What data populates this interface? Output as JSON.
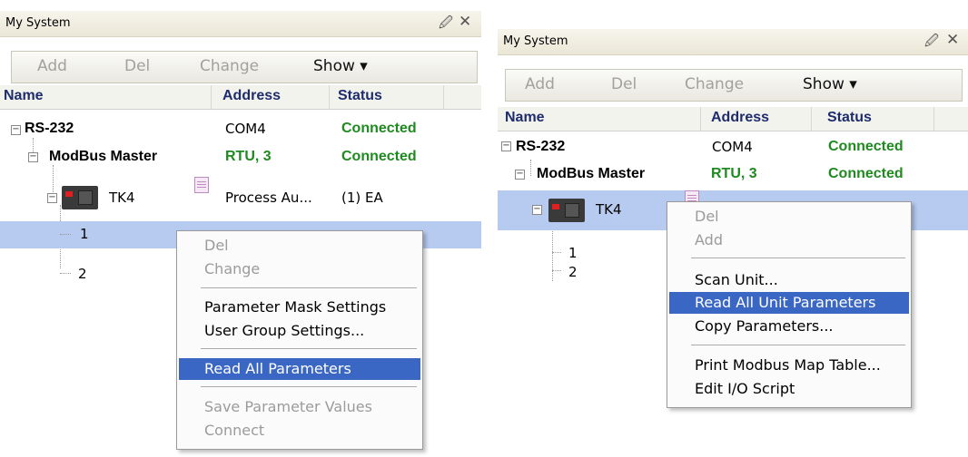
{
  "left": {
    "title": "My System",
    "toolbar": {
      "add": "Add",
      "del": "Del",
      "change": "Change",
      "show": "Show ▾"
    },
    "columns": {
      "name": "Name",
      "address": "Address",
      "status": "Status"
    },
    "rows": [
      {
        "name": "RS-232",
        "address": "COM4",
        "status": "Connected"
      },
      {
        "name": "ModBus Master",
        "address": "RTU, 3",
        "status": "Connected"
      },
      {
        "name": "TK4",
        "address": "Process Au...",
        "status": "(1) EA"
      },
      {
        "name": "1"
      },
      {
        "name": "2"
      }
    ],
    "menu": [
      "Del",
      "Change",
      "Parameter Mask Settings",
      "User Group Settings...",
      "Read All Parameters",
      "Save Parameter Values",
      "Connect"
    ]
  },
  "right": {
    "title": "My System",
    "toolbar": {
      "add": "Add",
      "del": "Del",
      "change": "Change",
      "show": "Show ▾"
    },
    "columns": {
      "name": "Name",
      "address": "Address",
      "status": "Status"
    },
    "rows": [
      {
        "name": "RS-232",
        "address": "COM4",
        "status": "Connected"
      },
      {
        "name": "ModBus Master",
        "address": "RTU, 3",
        "status": "Connected"
      },
      {
        "name": "TK4"
      },
      {
        "name": "1"
      },
      {
        "name": "2"
      }
    ],
    "menu": [
      "Del",
      "Add",
      "Scan Unit...",
      "Read All Unit Parameters",
      "Copy Parameters...",
      "Print Modbus Map Table...",
      "Edit I/O Script"
    ]
  },
  "icons": {
    "pin": "pin-icon",
    "close": "close-icon",
    "device": "tk4-device-icon",
    "doc": "document-icon"
  }
}
